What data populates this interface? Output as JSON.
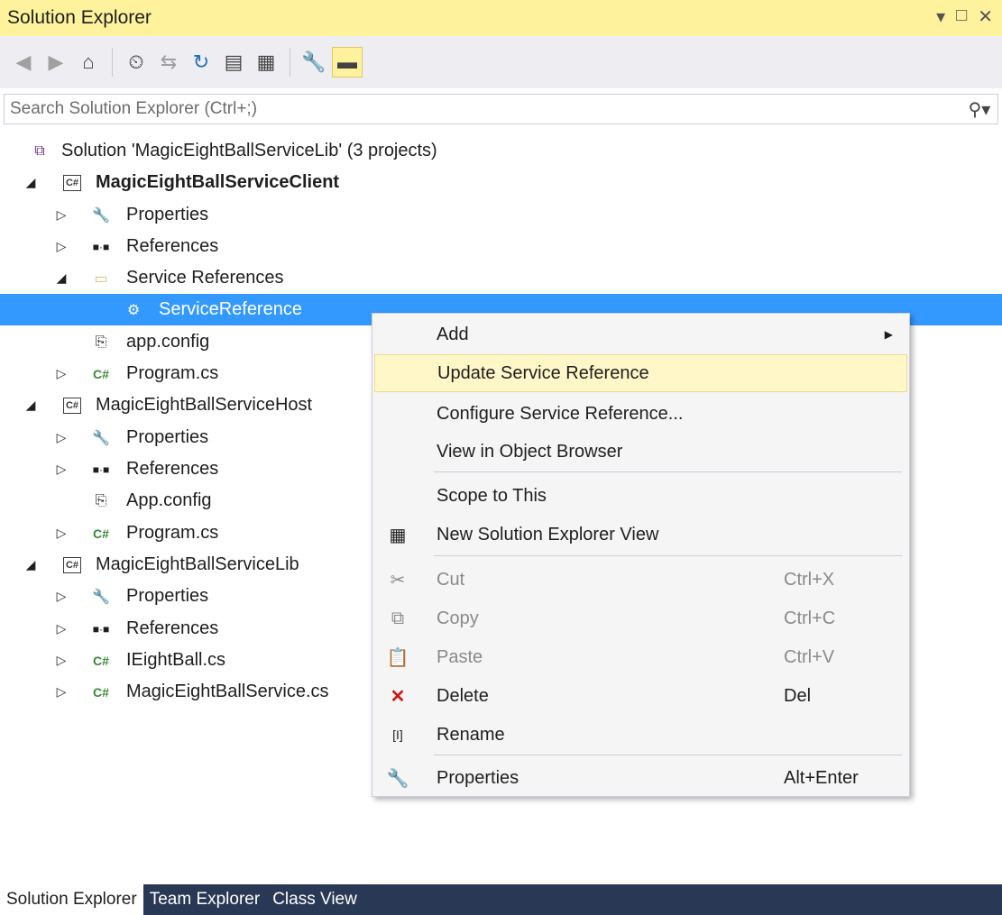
{
  "panel": {
    "title": "Solution Explorer"
  },
  "window_controls": {
    "dropdown": "▾",
    "maximize": "□",
    "close": "✕"
  },
  "toolbar": {
    "buttons": [
      {
        "icon": "back-icon",
        "glyph": "◀"
      },
      {
        "icon": "forward-icon",
        "glyph": "▶"
      },
      {
        "icon": "home-icon",
        "glyph": "⌂"
      },
      {
        "icon": "pending-changes-filter-icon",
        "glyph": "⏲"
      },
      {
        "icon": "sync-with-document-icon",
        "glyph": "⇆"
      },
      {
        "icon": "refresh-icon",
        "glyph": "↻"
      },
      {
        "icon": "collapse-all-icon",
        "glyph": "▤"
      },
      {
        "icon": "show-all-files-icon",
        "glyph": "▦"
      },
      {
        "icon": "properties-wrench-icon",
        "glyph": "🔧"
      },
      {
        "icon": "preview-selected-items-icon",
        "glyph": "▬"
      }
    ]
  },
  "search": {
    "placeholder": "Search Solution Explorer (Ctrl+;)",
    "icon": "search-icon"
  },
  "tree": {
    "solution": "Solution 'MagicEightBallServiceLib' (3 projects)",
    "items": [
      {
        "label": "MagicEightBallServiceClient"
      },
      {
        "label": "Properties"
      },
      {
        "label": "References"
      },
      {
        "label": "Service References"
      },
      {
        "label": "ServiceReference"
      },
      {
        "label": "app.config"
      },
      {
        "label": "Program.cs"
      },
      {
        "label": "MagicEightBallServiceHost"
      },
      {
        "label": "Properties"
      },
      {
        "label": "References"
      },
      {
        "label": "App.config"
      },
      {
        "label": "Program.cs"
      },
      {
        "label": "MagicEightBallServiceLib"
      },
      {
        "label": "Properties"
      },
      {
        "label": "References"
      },
      {
        "label": "IEightBall.cs"
      },
      {
        "label": "MagicEightBallService.cs"
      }
    ]
  },
  "context_menu": {
    "items": [
      {
        "label": "Add",
        "shortcut": ""
      },
      {
        "label": "Update Service Reference",
        "shortcut": ""
      },
      {
        "label": "Configure Service Reference...",
        "shortcut": ""
      },
      {
        "label": "View in Object Browser",
        "shortcut": ""
      },
      {
        "label": "Scope to This",
        "shortcut": ""
      },
      {
        "label": "New Solution Explorer View",
        "shortcut": ""
      },
      {
        "label": "Cut",
        "shortcut": "Ctrl+X"
      },
      {
        "label": "Copy",
        "shortcut": "Ctrl+C"
      },
      {
        "label": "Paste",
        "shortcut": "Ctrl+V"
      },
      {
        "label": "Delete",
        "shortcut": "Del"
      },
      {
        "label": "Rename",
        "shortcut": ""
      },
      {
        "label": "Properties",
        "shortcut": "Alt+Enter"
      }
    ]
  },
  "bottom_tabs": [
    {
      "label": "Solution Explorer"
    },
    {
      "label": "Team Explorer"
    },
    {
      "label": "Class View"
    }
  ],
  "colors": {
    "title_bg": "#fff29d",
    "selection": "#3399ff",
    "tab_bar": "#293955",
    "menu_highlight": "#fff7c8"
  }
}
